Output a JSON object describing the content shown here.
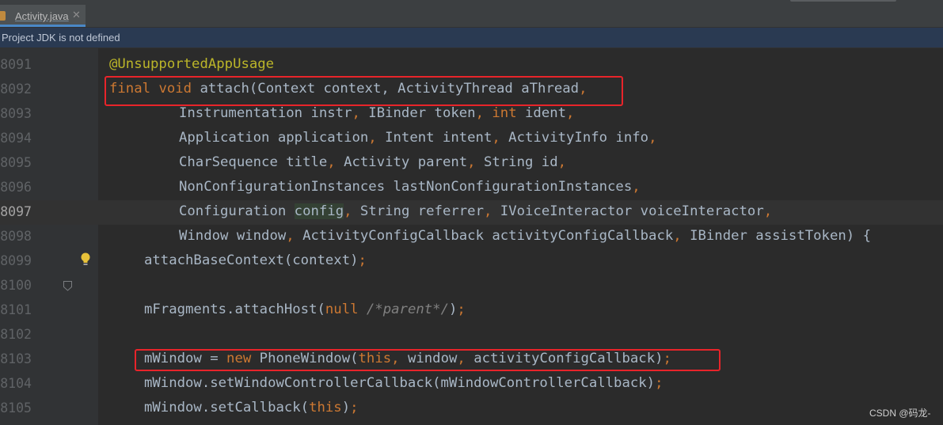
{
  "tab": {
    "label": "Activity.java",
    "close": "✕",
    "icon": "java-file-icon"
  },
  "banner": {
    "text": "Project JDK is not defined"
  },
  "watermark": "CSDN @码龙-",
  "colors": {
    "keyword": "#cc7832",
    "annotation": "#bbb529",
    "text": "#a9b7c6",
    "comment": "#808080",
    "highlight_box": "#e8242a",
    "background": "#2b2b2b"
  },
  "lines": [
    {
      "num": "8091",
      "a": "@UnsupportedAppUsage"
    },
    {
      "num": "8092",
      "a": "final",
      "b": "void",
      "c": "attach(Context context, ActivityThread aThread",
      "d": ","
    },
    {
      "num": "8093",
      "a": "Instrumentation instr",
      "b": ",",
      "c": " IBinder token",
      "d": ",",
      "e": "int",
      "f": " ident",
      "g": ","
    },
    {
      "num": "8094",
      "a": "Application application",
      "b": ",",
      "c": " Intent intent",
      "d": ",",
      "e": " ActivityInfo info",
      "f": ","
    },
    {
      "num": "8095",
      "a": "CharSequence title",
      "b": ",",
      "c": " Activity parent",
      "d": ",",
      "e": " String id",
      "f": ","
    },
    {
      "num": "8096",
      "a": "NonConfigurationInstances lastNonConfigurationInstances",
      "b": ","
    },
    {
      "num": "8097",
      "a": "Configuration ",
      "b": "config",
      "c": ",",
      "d": " String referrer",
      "e": ",",
      "f": " IVoiceInteractor voiceInteractor",
      "g": ","
    },
    {
      "num": "8098",
      "a": "Window window",
      "b": ",",
      "c": " ActivityConfigCallback activityConfigCallback",
      "d": ",",
      "e": " IBinder assistToken) {"
    },
    {
      "num": "8099",
      "a": "attachBaseContext(context)",
      "b": ";"
    },
    {
      "num": "8100"
    },
    {
      "num": "8101",
      "a": "mFragments.attachHost(",
      "b": "null",
      "c": " /*parent*/",
      "d": ")",
      "e": ";"
    },
    {
      "num": "8102"
    },
    {
      "num": "8103",
      "a": "mWindow = ",
      "b": "new",
      "c": " PhoneWindow(",
      "d": "this,",
      "e": " window",
      "f": ",",
      "g": " activityConfigCallback)",
      "h": ";"
    },
    {
      "num": "8104",
      "a": "mWindow.setWindowControllerCallback(mWindowControllerCallback)",
      "b": ";"
    },
    {
      "num": "8105",
      "a": "mWindow.setCallback(",
      "b": "this",
      "c": ")",
      "d": ";"
    }
  ]
}
